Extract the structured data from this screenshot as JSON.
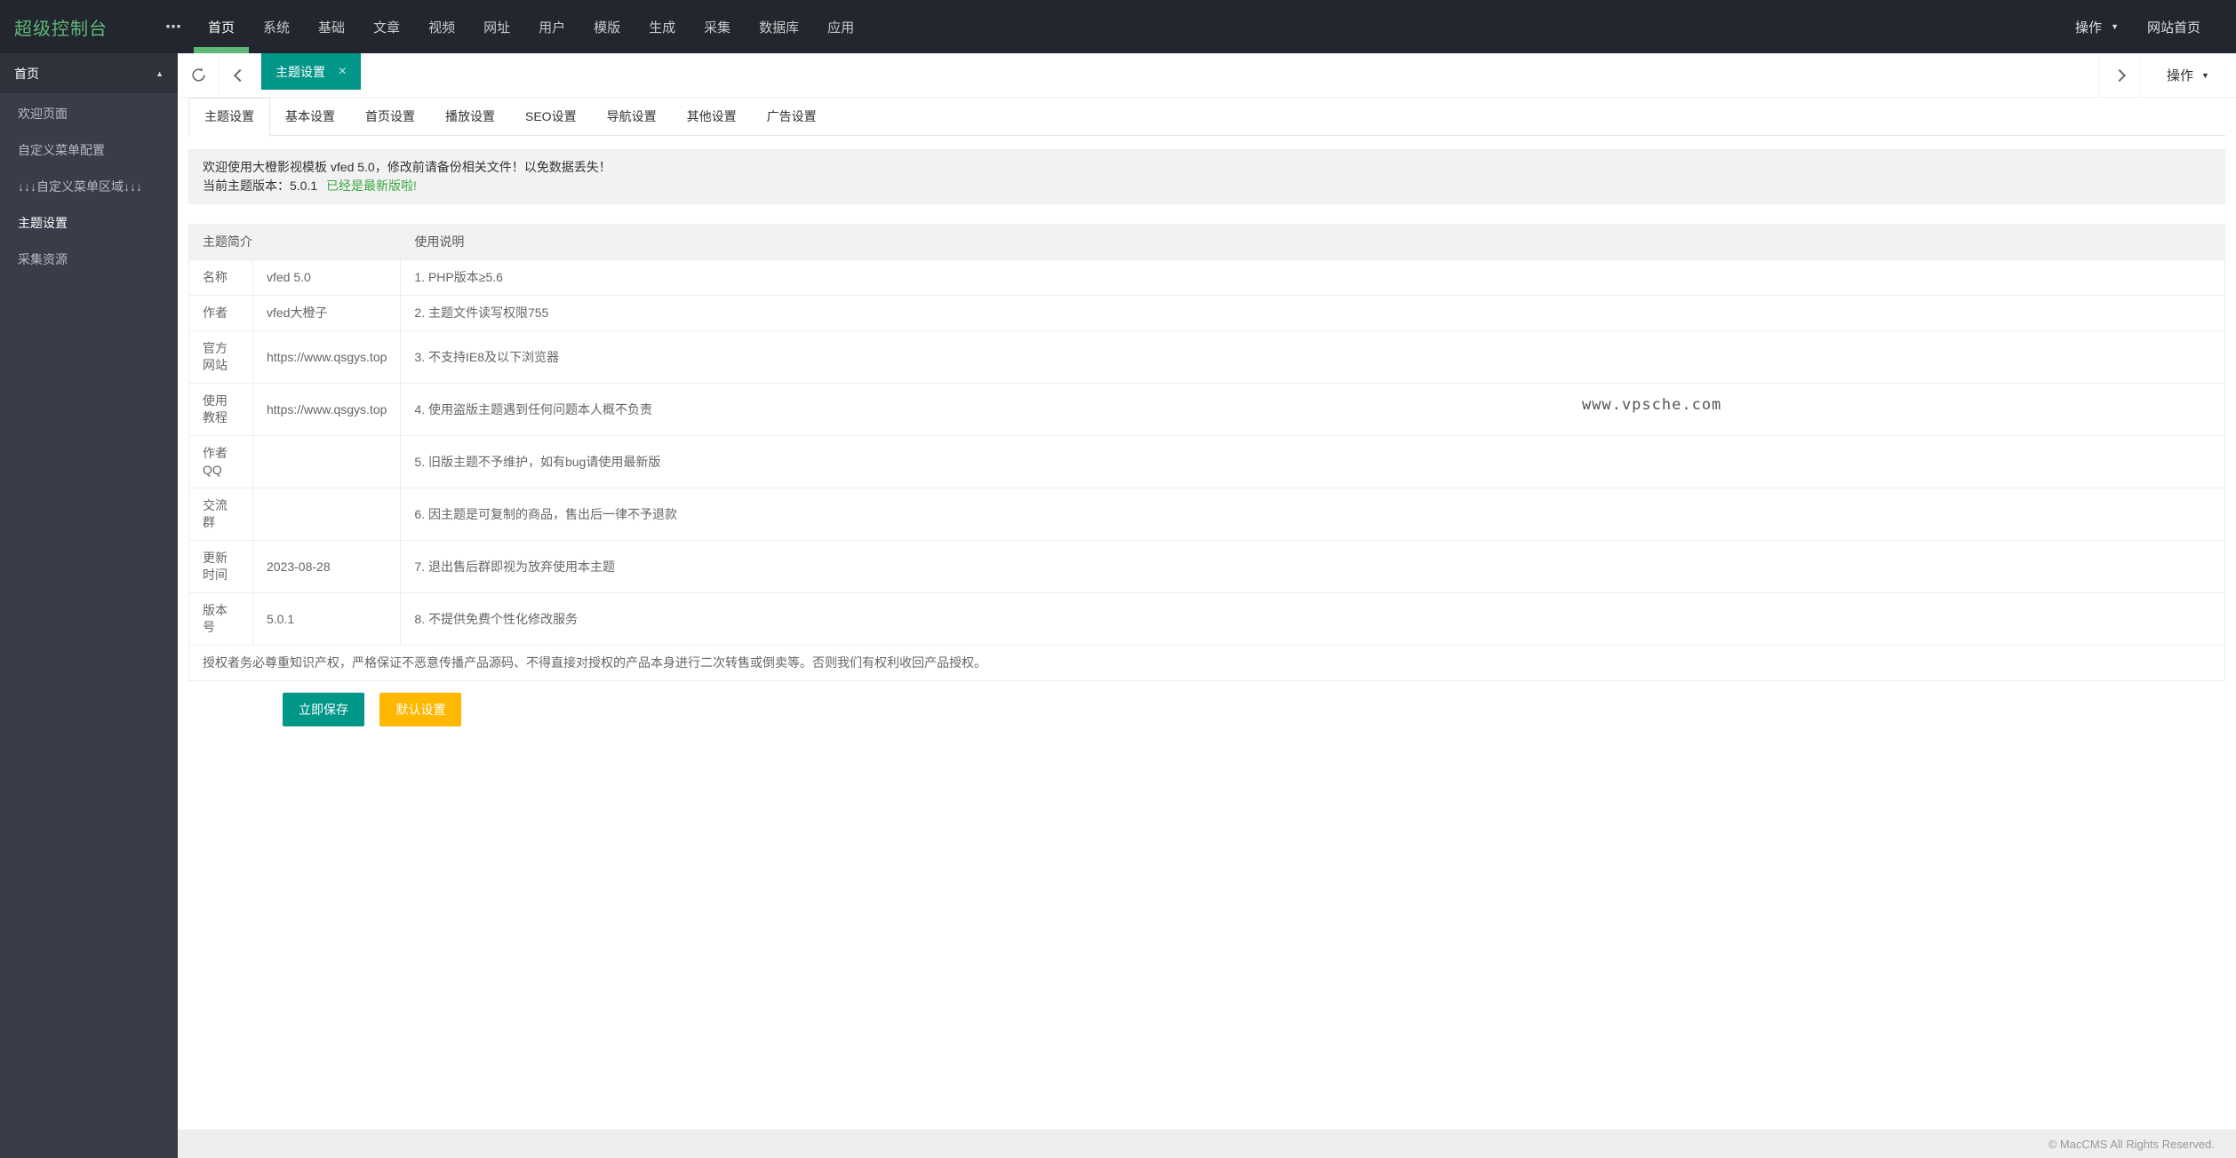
{
  "topbar": {
    "logo": "超级控制台",
    "more_icon": "⋯",
    "menu": [
      {
        "label": "首页",
        "active": true
      },
      {
        "label": "系统"
      },
      {
        "label": "基础"
      },
      {
        "label": "文章"
      },
      {
        "label": "视频"
      },
      {
        "label": "网址"
      },
      {
        "label": "用户"
      },
      {
        "label": "模版"
      },
      {
        "label": "生成"
      },
      {
        "label": "采集"
      },
      {
        "label": "数据库"
      },
      {
        "label": "应用"
      }
    ],
    "action_label": "操作",
    "caret_down_icon": "▼",
    "site_home_label": "网站首页"
  },
  "sidebar": {
    "group_title": "首页",
    "collapse_icon": "▲",
    "items": [
      {
        "label": "欢迎页面"
      },
      {
        "label": "自定义菜单配置"
      },
      {
        "label": "↓↓↓自定义菜单区域↓↓↓"
      },
      {
        "label": "主题设置",
        "active": true
      },
      {
        "label": "采集资源"
      }
    ]
  },
  "tabbar": {
    "active_tab_label": "主题设置",
    "close_icon": "×",
    "action_label": "操作",
    "caret_down_icon": "▼"
  },
  "subtabs": [
    {
      "label": "主题设置",
      "active": true
    },
    {
      "label": "基本设置"
    },
    {
      "label": "首页设置"
    },
    {
      "label": "播放设置"
    },
    {
      "label": "SEO设置"
    },
    {
      "label": "导航设置"
    },
    {
      "label": "其他设置"
    },
    {
      "label": "广告设置"
    }
  ],
  "notice": {
    "line1": "欢迎使用大橙影视模板 vfed 5.0，修改前请备份相关文件！以免数据丢失！",
    "line2_prefix": "当前主题版本：5.0.1",
    "line2_highlight": "已经是最新版啦!"
  },
  "table": {
    "header_intro": "主题简介",
    "header_usage": "使用说明",
    "rows": [
      {
        "label": "名称",
        "value": "vfed 5.0",
        "note": "1. PHP版本≥5.6"
      },
      {
        "label": "作者",
        "value": "vfed大橙子",
        "note": "2. 主题文件读写权限755"
      },
      {
        "label": "官方网站",
        "value": "https://www.qsgys.top",
        "note": "3. 不支持IE8及以下浏览器"
      },
      {
        "label": "使用教程",
        "value": "https://www.qsgys.top",
        "note": "4. 使用盗版主题遇到任何问题本人概不负责"
      },
      {
        "label": "作者QQ",
        "value": "",
        "note": "5. 旧版主题不予维护，如有bug请使用最新版"
      },
      {
        "label": "交流群",
        "value": "",
        "note": "6. 因主题是可复制的商品，售出后一律不予退款"
      },
      {
        "label": "更新时间",
        "value": "2023-08-28",
        "note": "7. 退出售后群即视为放弃使用本主题"
      },
      {
        "label": "版本号",
        "value": "5.0.1",
        "note": "8. 不提供免费个性化修改服务"
      }
    ],
    "footer_note": "授权者务必尊重知识产权，严格保证不恶意传播产品源码、不得直接对授权的产品本身进行二次转售或倒卖等。否则我们有权利收回产品授权。"
  },
  "buttons": {
    "save": "立即保存",
    "default": "默认设置"
  },
  "watermark": "www.vpsche.com",
  "footer_text": "© MacCMS All Rights Reserved.",
  "colors": {
    "topbar_bg": "#23262E",
    "sidebar_bg": "#393D49",
    "accent_teal": "#009688",
    "accent_green": "#5FB878",
    "accent_orange": "#FFB800"
  }
}
